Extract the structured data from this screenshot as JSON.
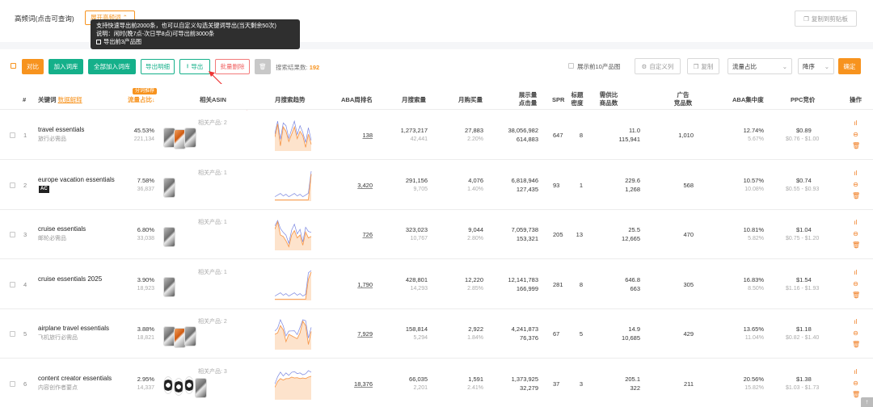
{
  "header": {
    "title": "高频词(点击可查询)",
    "tab_label": "展开高频词",
    "copy_btn": "复制到剪贴板"
  },
  "tooltip": {
    "line1": "支持快速导出前2000条，也可以自定义勾选关键词导出(当天剩余50次)",
    "line2": "说明：闲时(晚7点-次日早8点)可导出前3000条",
    "option": "导出前3产品图"
  },
  "toolbar": {
    "compare": "对比",
    "add_lib": "加入词库",
    "add_all": "全部加入词库",
    "export_detail": "导出明细",
    "export": "导出",
    "batch_delete": "批量删除",
    "result_label": "搜索结果数:",
    "result_count": "192",
    "show_top10": "展示前10产品图",
    "custom_col": "自定义列",
    "copy": "复制",
    "sort_field": "流量占比",
    "sort_order": "降序",
    "confirm": "确定"
  },
  "columns": {
    "idx": "#",
    "keyword": "关键词",
    "data_explain": "数据解释",
    "share_badge": "分词推荐",
    "share": "流量占比",
    "asin": "相关ASIN",
    "trend": "月搜索趋势",
    "aba": "ABA周排名",
    "monthly_search": "月搜索量",
    "monthly_buy": "月购买量",
    "impressions_l1": "展示量",
    "impressions_l2": "点击量",
    "spr": "SPR",
    "title_density_l1": "标题",
    "title_density_l2": "密度",
    "supply_l1": "需供比",
    "supply_l2": "商品数",
    "ad_l1": "广告",
    "ad_l2": "竞品数",
    "aba_conc": "ABA集中度",
    "ppc": "PPC竞价",
    "ops": "操作"
  },
  "rows": [
    {
      "idx": "1",
      "kw": "travel essentials",
      "kw_cn": "旅行必需品",
      "ac": false,
      "share": "45.53%",
      "share_sub": "221,134",
      "related": "相关产品: 2",
      "aba": "138",
      "ms": "1,273,217",
      "ms_sub": "42,441",
      "mb": "27,883",
      "mb_sub": "2.20%",
      "imp": "38,056,982",
      "clk": "614,883",
      "spr": "647",
      "td": "8",
      "ratio": "11.0",
      "goods": "115,941",
      "ad": "1,010",
      "conc": "12.74%",
      "conc_sub": "5.67%",
      "ppc": "$0.89",
      "ppc_range": "$0.76 - $1.00",
      "thumbs": [
        "g",
        "o",
        "g"
      ],
      "trend": [
        0.55,
        0.1,
        0.85,
        0.2,
        0.35,
        0.7,
        0.45,
        0.2,
        0.6,
        0.35,
        0.5,
        0.9,
        0.45,
        0.8
      ]
    },
    {
      "idx": "2",
      "kw": "europe vacation essentials",
      "kw_cn": "",
      "ac": true,
      "share": "7.58%",
      "share_sub": "36,837",
      "related": "相关产品: 1",
      "aba": "3,420",
      "ms": "291,156",
      "ms_sub": "9,705",
      "mb": "4,076",
      "mb_sub": "1.40%",
      "imp": "6,818,946",
      "clk": "127,435",
      "spr": "93",
      "td": "1",
      "ratio": "229.6",
      "goods": "1,268",
      "ad": "568",
      "conc": "10.57%",
      "conc_sub": "10.08%",
      "ppc": "$0.74",
      "ppc_range": "$0.55 - $0.93",
      "thumbs": [
        "g"
      ],
      "trend": [
        0.99,
        0.99,
        0.99,
        0.99,
        0.99,
        0.99,
        0.99,
        0.99,
        0.99,
        0.99,
        0.99,
        0.99,
        0.98,
        0.1
      ]
    },
    {
      "idx": "3",
      "kw": "cruise essentials",
      "kw_cn": "邮轮必需品",
      "ac": false,
      "share": "6.80%",
      "share_sub": "33,038",
      "related": "相关产品: 1",
      "aba": "726",
      "ms": "323,023",
      "ms_sub": "10,767",
      "mb": "9,044",
      "mb_sub": "2.80%",
      "imp": "7,059,738",
      "clk": "153,321",
      "spr": "205",
      "td": "13",
      "ratio": "25.5",
      "goods": "12,665",
      "ad": "470",
      "conc": "10.81%",
      "conc_sub": "5.82%",
      "ppc": "$1.04",
      "ppc_range": "$0.75 - $1.20",
      "thumbs": [
        "g"
      ],
      "trend": [
        0.3,
        0.05,
        0.5,
        0.55,
        0.7,
        0.9,
        0.5,
        0.35,
        0.6,
        0.5,
        0.85,
        0.4,
        0.6,
        0.55
      ]
    },
    {
      "idx": "4",
      "kw": "cruise essentials 2025",
      "kw_cn": "",
      "ac": false,
      "share": "3.90%",
      "share_sub": "18,923",
      "related": "相关产品: 1",
      "aba": "1,790",
      "ms": "428,801",
      "ms_sub": "14,293",
      "mb": "12,220",
      "mb_sub": "2.85%",
      "imp": "12,141,783",
      "clk": "166,999",
      "spr": "281",
      "td": "8",
      "ratio": "646.8",
      "goods": "663",
      "ad": "305",
      "conc": "16.83%",
      "conc_sub": "8.50%",
      "ppc": "$1.54",
      "ppc_range": "$1.16 - $1.93",
      "thumbs": [
        "g"
      ],
      "trend": [
        0.99,
        0.99,
        0.99,
        0.99,
        0.99,
        0.99,
        0.99,
        0.99,
        0.99,
        0.99,
        0.99,
        0.99,
        0.3,
        0.05
      ]
    },
    {
      "idx": "5",
      "kw": "airplane travel essentials",
      "kw_cn": "飞机旅行必需品",
      "ac": false,
      "share": "3.88%",
      "share_sub": "18,821",
      "related": "相关产品: 2",
      "aba": "7,929",
      "ms": "158,814",
      "ms_sub": "5,294",
      "mb": "2,922",
      "mb_sub": "1.84%",
      "imp": "4,241,873",
      "clk": "76,376",
      "spr": "67",
      "td": "5",
      "ratio": "14.9",
      "goods": "10,685",
      "ad": "429",
      "conc": "13.65%",
      "conc_sub": "11.04%",
      "ppc": "$1.18",
      "ppc_range": "$0.82 - $1.40",
      "thumbs": [
        "g",
        "o",
        "g"
      ],
      "trend": [
        0.5,
        0.45,
        0.2,
        0.35,
        0.75,
        0.5,
        0.55,
        0.6,
        0.65,
        0.45,
        0.05,
        0.2,
        0.85,
        0.4
      ]
    },
    {
      "idx": "6",
      "kw": "content creator essentials",
      "kw_cn": "内容创作者要点",
      "ac": false,
      "share": "2.95%",
      "share_sub": "14,337",
      "related": "相关产品: 3",
      "aba": "18,376",
      "ms": "66,035",
      "ms_sub": "2,201",
      "mb": "1,591",
      "mb_sub": "2.41%",
      "imp": "1,373,925",
      "clk": "32,279",
      "spr": "37",
      "td": "3",
      "ratio": "205.1",
      "goods": "322",
      "ad": "211",
      "conc": "20.56%",
      "conc_sub": "15.82%",
      "ppc": "$1.38",
      "ppc_range": "$1.03 - $1.73",
      "thumbs": [
        "d",
        "d",
        "d",
        "g"
      ],
      "trend": [
        0.6,
        0.4,
        0.3,
        0.35,
        0.3,
        0.3,
        0.25,
        0.28,
        0.27,
        0.3,
        0.28,
        0.3,
        0.25,
        0.22
      ]
    }
  ],
  "colors": {
    "accent": "#f7931e",
    "teal": "#15b08a",
    "trend_orange": "#f79a4e",
    "trend_blue": "#7a86e0"
  },
  "icons": {
    "ops": [
      "bar-chart-icon",
      "more-icon",
      "delete-icon"
    ]
  }
}
